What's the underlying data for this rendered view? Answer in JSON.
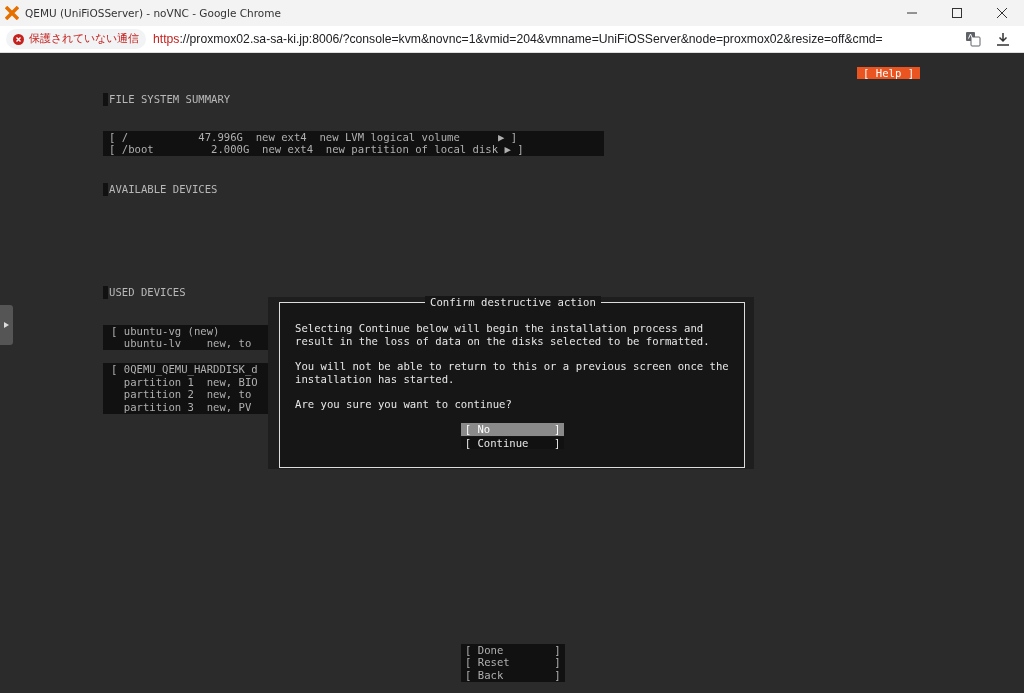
{
  "window": {
    "title": "QEMU (UniFiOSServer) - noVNC - Google Chrome"
  },
  "address_bar": {
    "security_label": "保護されていない通信",
    "url_scheme": "https",
    "url_rest": "://proxmox02.sa-sa-ki.jp:8006/?console=kvm&novnc=1&vmid=204&vmname=UniFiOSServer&node=proxmox02&resize=off&cmd="
  },
  "help_button": "[ Help ]",
  "file_system_summary": {
    "heading": "FILE SYSTEM SUMMARY",
    "rows": [
      {
        "text": "[ /           47.996G  new ext4  new LVM logical volume      ▶ ]"
      },
      {
        "text": "[ /boot         2.000G  new ext4  new partition of local disk ▶ ]"
      }
    ]
  },
  "available_devices": {
    "heading": "AVAILABLE DEVICES"
  },
  "used_devices": {
    "heading": "USED DEVICES",
    "groups": [
      {
        "lines": [
          "[ ubuntu-vg (new)",
          "  ubuntu-lv    new, to"
        ]
      },
      {
        "lines": [
          "[ 0QEMU_QEMU_HARDDISK_d",
          "  partition 1  new, BIO",
          "  partition 2  new, to",
          "  partition 3  new, PV"
        ]
      }
    ]
  },
  "dialog": {
    "title": "Confirm destructive action",
    "paragraphs": [
      "Selecting Continue below will begin the installation process and\nresult in the loss of data on the disks selected to be formatted.",
      "You will not be able to return to this or a previous screen once the\ninstallation has started.",
      "Are you sure you want to continue?"
    ],
    "buttons": [
      {
        "label": "[ No          ]",
        "selected": true
      },
      {
        "label": "[ Continue    ]",
        "selected": false
      }
    ]
  },
  "bottom_buttons": [
    {
      "label": "[ Done        ]"
    },
    {
      "label": "[ Reset       ]"
    },
    {
      "label": "[ Back        ]"
    }
  ]
}
